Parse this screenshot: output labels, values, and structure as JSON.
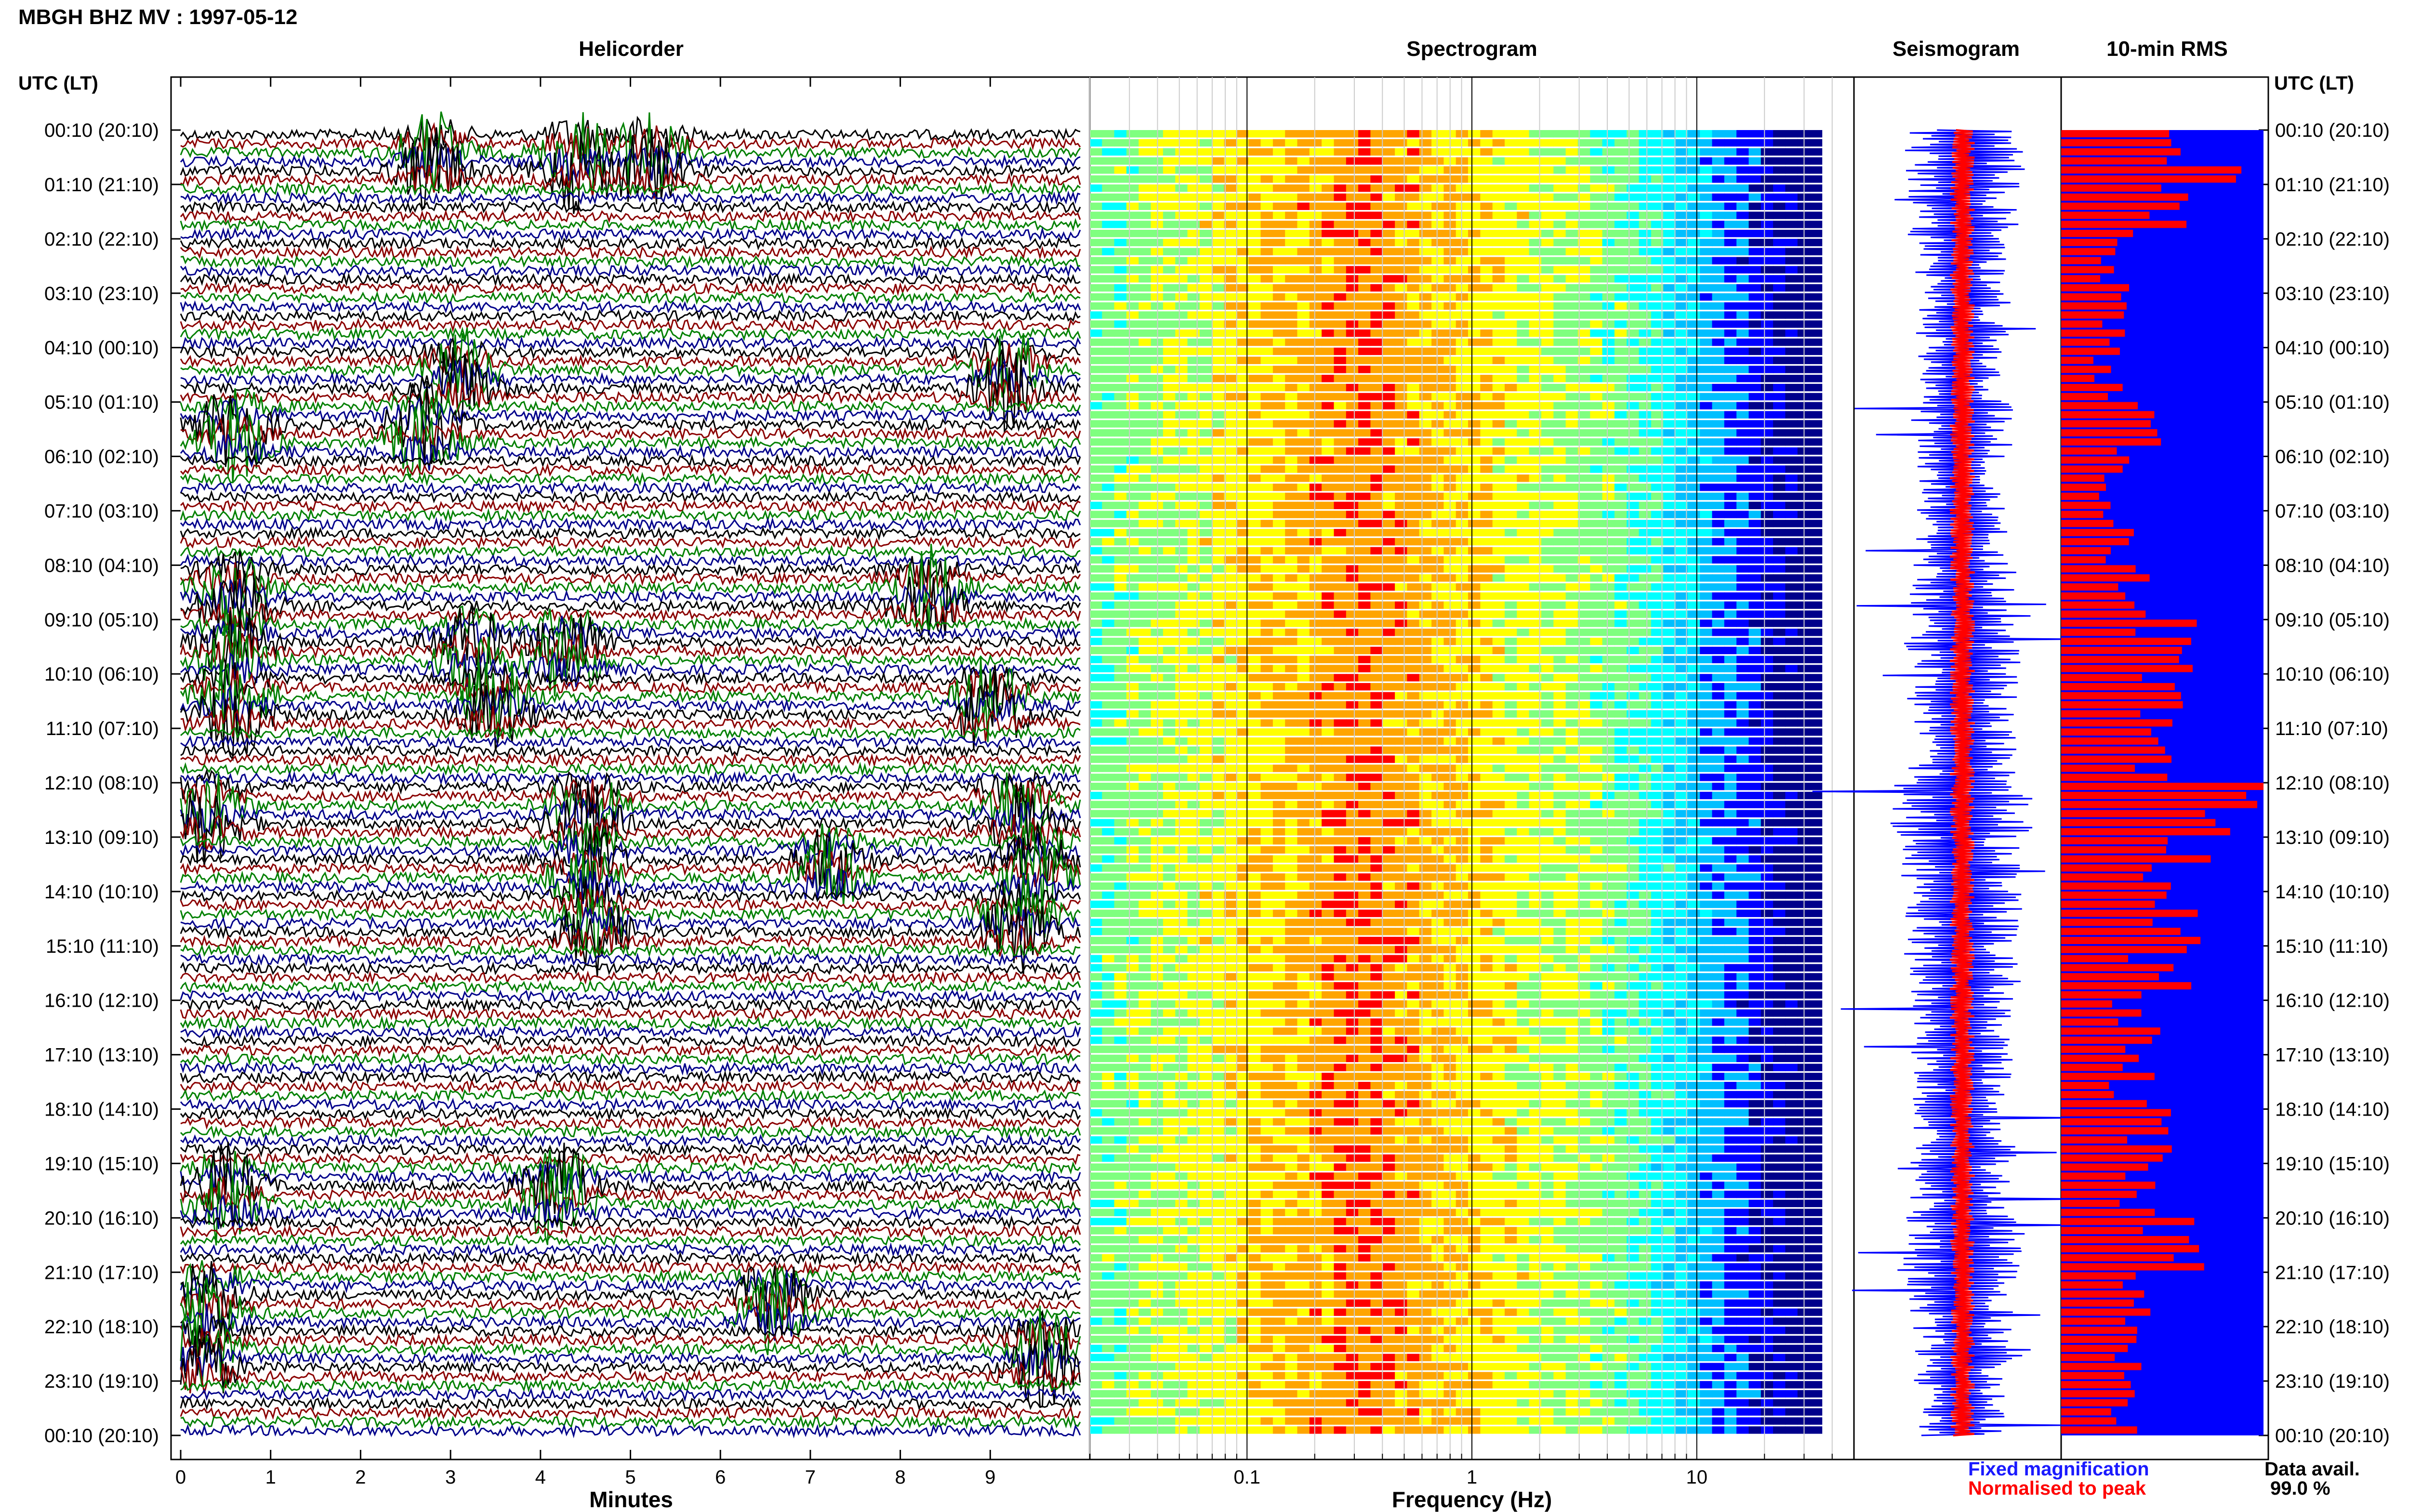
{
  "header": {
    "title": "MBGH BHZ MV : 1997-05-12"
  },
  "panels": {
    "helicorder": "Helicorder",
    "spectrogram": "Spectrogram",
    "seismogram": "Seismogram",
    "rms": "10-min RMS"
  },
  "axes": {
    "left_time_header": "UTC (LT)",
    "right_time_header": "UTC (LT)",
    "minutes_label": "Minutes",
    "frequency_label": "Frequency (Hz)"
  },
  "legend": {
    "fixed": "Fixed magnification",
    "normalised": "Normalised to peak",
    "fixed_color": "#1a1aff",
    "normalised_color": "#ff0000"
  },
  "data_availability": {
    "label": "Data avail.",
    "value": "99.0 %"
  },
  "colors": {
    "trace_cycle": [
      "#000000",
      "#8b0000",
      "#008000",
      "#00008b"
    ],
    "seismogram_fixed": "#0000ff",
    "seismogram_norm": "#ff0000",
    "rms_bar": "#ff0000",
    "rms_fill": "#0000ff"
  },
  "chart_data": [
    {
      "type": "line",
      "name": "Helicorder",
      "xlabel": "Minutes",
      "xlim": [
        0,
        10
      ],
      "x_ticks": [
        0,
        1,
        2,
        3,
        4,
        5,
        6,
        7,
        8,
        9
      ],
      "y_ticks_left": [
        "00:10 (20:10)",
        "01:10 (21:10)",
        "02:10 (22:10)",
        "03:10 (23:10)",
        "04:10 (00:10)",
        "05:10 (01:10)",
        "06:10 (02:10)",
        "07:10 (03:10)",
        "08:10 (04:10)",
        "09:10 (05:10)",
        "10:10 (06:10)",
        "11:10 (07:10)",
        "12:10 (08:10)",
        "13:10 (09:10)",
        "14:10 (10:10)",
        "15:10 (11:10)",
        "16:10 (12:10)",
        "17:10 (13:10)",
        "18:10 (14:10)",
        "19:10 (15:10)",
        "20:10 (16:10)",
        "21:10 (17:10)",
        "22:10 (18:10)",
        "23:10 (19:10)",
        "00:10 (20:10)"
      ],
      "rows_per_hour": 6,
      "events_minutes_by_hour": {
        "00": [
          2.8,
          4.4,
          5.2
        ],
        "04": [
          3.1,
          9.2
        ],
        "05": [
          0.6,
          2.7
        ],
        "08": [
          0.6,
          8.3
        ],
        "09": [
          0.6,
          3.2,
          4.3
        ],
        "10": [
          0.6,
          3.5,
          9.0
        ],
        "12": [
          0.3,
          4.5,
          9.3
        ],
        "13": [
          4.5,
          7.2,
          9.5
        ],
        "14": [
          4.6,
          9.3
        ],
        "19": [
          0.5,
          4.2
        ],
        "21": [
          0.3,
          6.6
        ],
        "22": [
          0.2,
          9.6
        ]
      }
    },
    {
      "type": "heatmap",
      "name": "Spectrogram",
      "xlabel": "Frequency (Hz)",
      "x_scale": "log",
      "xlim": [
        0.02,
        50
      ],
      "x_tick_labels": [
        "0.1",
        "1",
        "10"
      ],
      "peak_band_hz": [
        0.2,
        0.5
      ],
      "colormap": [
        "#00008b",
        "#0000ff",
        "#00bfff",
        "#00ffff",
        "#7fff7f",
        "#ffff00",
        "#ffa500",
        "#ff0000"
      ]
    },
    {
      "type": "line",
      "name": "Seismogram",
      "series": [
        {
          "name": "Fixed magnification",
          "color": "#0000ff"
        },
        {
          "name": "Normalised to peak",
          "color": "#ff0000"
        }
      ]
    },
    {
      "type": "bar",
      "name": "10-min RMS",
      "orientation": "horizontal",
      "y_ticks_right": [
        "00:10 (20:10)",
        "01:10 (21:10)",
        "02:10 (22:10)",
        "03:10 (23:10)",
        "04:10 (00:10)",
        "05:10 (01:10)",
        "06:10 (02:10)",
        "07:10 (03:10)",
        "08:10 (04:10)",
        "09:10 (05:10)",
        "10:10 (06:10)",
        "11:10 (07:10)",
        "12:10 (08:10)",
        "13:10 (09:10)",
        "14:10 (10:10)",
        "15:10 (11:10)",
        "16:10 (12:10)",
        "17:10 (13:10)",
        "18:10 (14:10)",
        "19:10 (15:10)",
        "20:10 (16:10)",
        "21:10 (17:10)",
        "22:10 (18:10)",
        "23:10 (19:10)",
        "00:10 (20:10)"
      ],
      "hourly_peak_relative": [
        0.85,
        0.6,
        0.35,
        0.32,
        0.28,
        0.45,
        0.33,
        0.35,
        0.5,
        0.62,
        0.55,
        0.5,
        0.95,
        0.7,
        0.65,
        0.6,
        0.45,
        0.42,
        0.5,
        0.45,
        0.7,
        0.55,
        0.4,
        0.35
      ]
    }
  ]
}
